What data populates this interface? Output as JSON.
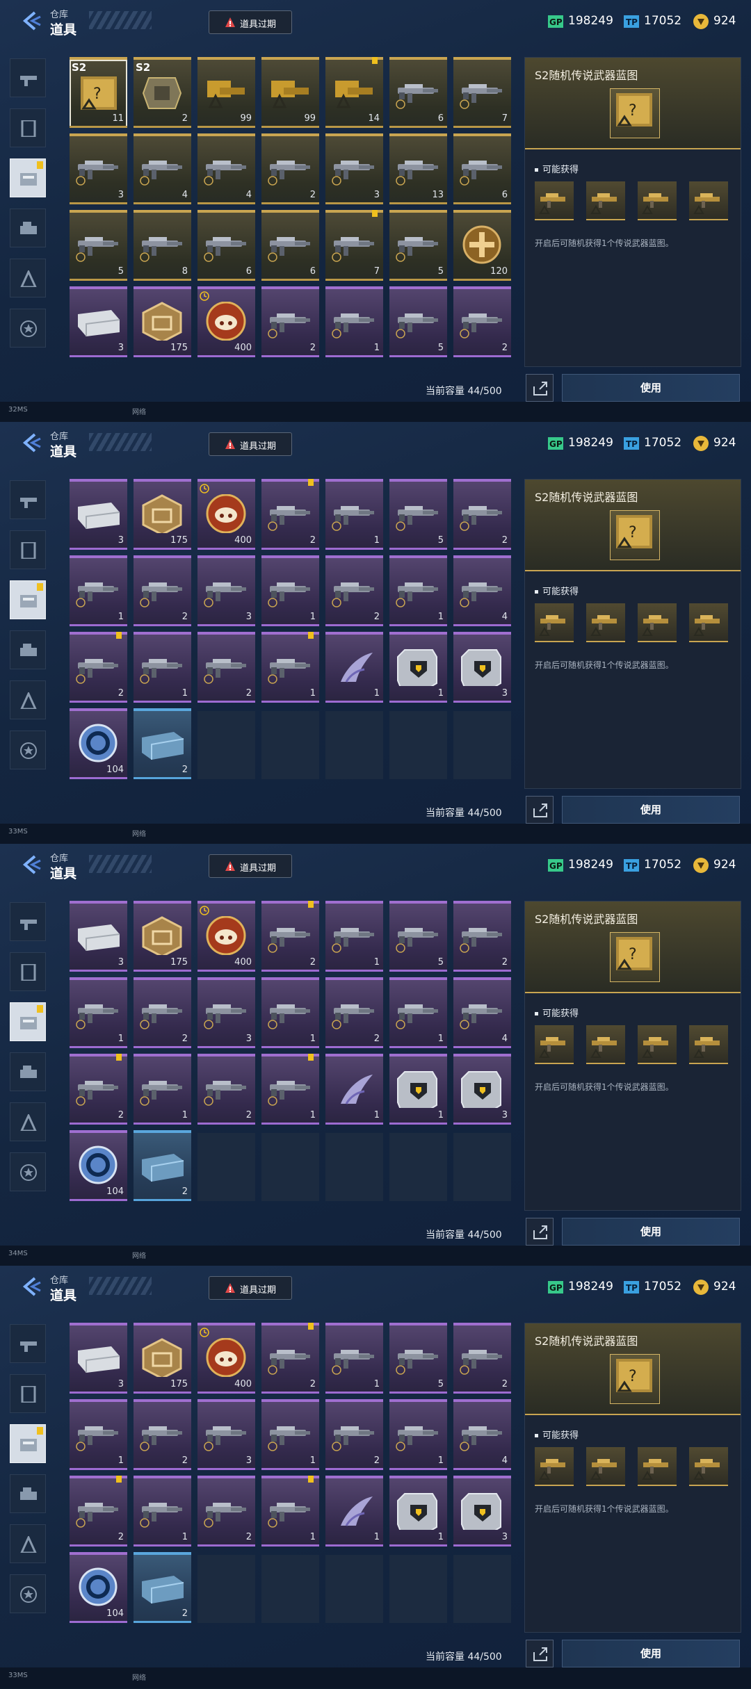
{
  "header": {
    "breadcrumb": "仓库",
    "title": "道具",
    "expired_label": "道具过期",
    "currencies": [
      {
        "icon": "gp-currency-icon",
        "value": "198249"
      },
      {
        "icon": "tp-currency-icon",
        "value": "17052"
      },
      {
        "icon": "gold-coin-icon",
        "value": "924"
      }
    ]
  },
  "tabs": [
    {
      "name": "weapons",
      "icon": "rifle-icon"
    },
    {
      "name": "cards",
      "icon": "card-icon"
    },
    {
      "name": "items",
      "icon": "item-pack-icon"
    },
    {
      "name": "vehicles",
      "icon": "vehicle-icon"
    },
    {
      "name": "blueprints",
      "icon": "blueprint-icon"
    },
    {
      "name": "badges",
      "icon": "star-badge-icon"
    }
  ],
  "detail": {
    "title": "S2随机传说武器蓝图",
    "obtain_label": "可能获得",
    "description": "开启后可随机获得1个传说武器蓝图。",
    "use_button": "使用"
  },
  "capacity": "当前容量 44/500",
  "screens": [
    {
      "fps": "32MS",
      "extra": "网络",
      "rows": [
        [
          {
            "rarity": "gold",
            "icon": "blueprint-crate-icon",
            "count": "11",
            "tag": "S2",
            "selected": true
          },
          {
            "rarity": "gold",
            "icon": "supply-crate-icon",
            "count": "2",
            "tag": "S2"
          },
          {
            "rarity": "gold",
            "icon": "gold-blueprint-icon",
            "count": "99"
          },
          {
            "rarity": "gold",
            "icon": "gold-blueprint-icon",
            "count": "99"
          },
          {
            "rarity": "gold",
            "icon": "gold-blueprint-icon",
            "count": "14",
            "new": true
          },
          {
            "rarity": "gold",
            "icon": "rifle-blueprint-icon",
            "count": "6"
          },
          {
            "rarity": "gold",
            "icon": "rifle-blueprint-icon",
            "count": "7"
          }
        ],
        [
          {
            "rarity": "gold",
            "icon": "rifle-blueprint-icon",
            "count": "3"
          },
          {
            "rarity": "gold",
            "icon": "rifle-blueprint-icon",
            "count": "4"
          },
          {
            "rarity": "gold",
            "icon": "rifle-blueprint-icon",
            "count": "4"
          },
          {
            "rarity": "gold",
            "icon": "rifle-blueprint-icon",
            "count": "2"
          },
          {
            "rarity": "gold",
            "icon": "rifle-blueprint-icon",
            "count": "3"
          },
          {
            "rarity": "gold",
            "icon": "rifle-blueprint-icon",
            "count": "13"
          },
          {
            "rarity": "gold",
            "icon": "rifle-blueprint-icon",
            "count": "6"
          }
        ],
        [
          {
            "rarity": "gold",
            "icon": "rifle-blueprint-icon",
            "count": "5"
          },
          {
            "rarity": "gold",
            "icon": "rifle-blueprint-icon",
            "count": "8"
          },
          {
            "rarity": "gold",
            "icon": "rifle-blueprint-icon",
            "count": "6"
          },
          {
            "rarity": "gold",
            "icon": "rifle-blueprint-icon",
            "count": "6"
          },
          {
            "rarity": "gold",
            "icon": "rifle-blueprint-icon",
            "count": "7",
            "new": true
          },
          {
            "rarity": "gold",
            "icon": "rifle-blueprint-icon",
            "count": "5"
          },
          {
            "rarity": "gold",
            "icon": "gold-cross-coin-icon",
            "count": "120"
          }
        ],
        [
          {
            "rarity": "purple",
            "icon": "silver-case-icon",
            "count": "3"
          },
          {
            "rarity": "purple",
            "icon": "hex-badge-icon",
            "count": "175"
          },
          {
            "rarity": "purple",
            "icon": "pig-token-icon",
            "count": "400",
            "clock": true
          },
          {
            "rarity": "purple",
            "icon": "rifle-blueprint-icon",
            "count": "2"
          },
          {
            "rarity": "purple",
            "icon": "rifle-blueprint-icon",
            "count": "1"
          },
          {
            "rarity": "purple",
            "icon": "rifle-blueprint-icon",
            "count": "5"
          },
          {
            "rarity": "purple",
            "icon": "rifle-blueprint-icon",
            "count": "2"
          }
        ]
      ]
    },
    {
      "fps": "33MS",
      "extra": "网络",
      "rows": [
        [
          {
            "rarity": "purple",
            "icon": "silver-case-icon",
            "count": "3"
          },
          {
            "rarity": "purple",
            "icon": "hex-badge-icon",
            "count": "175"
          },
          {
            "rarity": "purple",
            "icon": "pig-token-icon",
            "count": "400",
            "clock": true
          },
          {
            "rarity": "purple",
            "icon": "rifle-blueprint-icon",
            "count": "2",
            "new": true
          },
          {
            "rarity": "purple",
            "icon": "rifle-blueprint-icon",
            "count": "1"
          },
          {
            "rarity": "purple",
            "icon": "rifle-blueprint-icon",
            "count": "5"
          },
          {
            "rarity": "purple",
            "icon": "rifle-blueprint-icon",
            "count": "2"
          }
        ],
        [
          {
            "rarity": "purple",
            "icon": "rifle-blueprint-icon",
            "count": "1"
          },
          {
            "rarity": "purple",
            "icon": "rifle-blueprint-icon",
            "count": "2"
          },
          {
            "rarity": "purple",
            "icon": "rifle-blueprint-icon",
            "count": "3"
          },
          {
            "rarity": "purple",
            "icon": "rifle-blueprint-icon",
            "count": "1"
          },
          {
            "rarity": "purple",
            "icon": "rifle-blueprint-icon",
            "count": "2"
          },
          {
            "rarity": "purple",
            "icon": "rifle-blueprint-icon",
            "count": "1"
          },
          {
            "rarity": "purple",
            "icon": "rifle-blueprint-icon",
            "count": "4"
          }
        ],
        [
          {
            "rarity": "purple",
            "icon": "rifle-blueprint-icon",
            "count": "2",
            "new": true
          },
          {
            "rarity": "purple",
            "icon": "rifle-blueprint-icon",
            "count": "1"
          },
          {
            "rarity": "purple",
            "icon": "rifle-blueprint-icon",
            "count": "2"
          },
          {
            "rarity": "purple",
            "icon": "rifle-blueprint-icon",
            "count": "1",
            "new": true
          },
          {
            "rarity": "purple",
            "icon": "claw-blade-icon",
            "count": "1"
          },
          {
            "rarity": "purple",
            "icon": "shield-card-icon",
            "count": "1"
          },
          {
            "rarity": "purple",
            "icon": "shield-card-icon",
            "count": "3"
          }
        ],
        [
          {
            "rarity": "purple",
            "icon": "blue-ring-token-icon",
            "count": "104"
          },
          {
            "rarity": "blue",
            "icon": "supply-box-icon",
            "count": "2"
          },
          {
            "rarity": "empty"
          },
          {
            "rarity": "empty"
          },
          {
            "rarity": "empty"
          },
          {
            "rarity": "empty"
          },
          {
            "rarity": "empty"
          }
        ]
      ]
    },
    {
      "fps": "34MS",
      "extra": "网络",
      "rows": [
        [
          {
            "rarity": "purple",
            "icon": "silver-case-icon",
            "count": "3"
          },
          {
            "rarity": "purple",
            "icon": "hex-badge-icon",
            "count": "175"
          },
          {
            "rarity": "purple",
            "icon": "pig-token-icon",
            "count": "400",
            "clock": true
          },
          {
            "rarity": "purple",
            "icon": "rifle-blueprint-icon",
            "count": "2",
            "new": true
          },
          {
            "rarity": "purple",
            "icon": "rifle-blueprint-icon",
            "count": "1"
          },
          {
            "rarity": "purple",
            "icon": "rifle-blueprint-icon",
            "count": "5"
          },
          {
            "rarity": "purple",
            "icon": "rifle-blueprint-icon",
            "count": "2"
          }
        ],
        [
          {
            "rarity": "purple",
            "icon": "rifle-blueprint-icon",
            "count": "1"
          },
          {
            "rarity": "purple",
            "icon": "rifle-blueprint-icon",
            "count": "2"
          },
          {
            "rarity": "purple",
            "icon": "rifle-blueprint-icon",
            "count": "3"
          },
          {
            "rarity": "purple",
            "icon": "rifle-blueprint-icon",
            "count": "1"
          },
          {
            "rarity": "purple",
            "icon": "rifle-blueprint-icon",
            "count": "2"
          },
          {
            "rarity": "purple",
            "icon": "rifle-blueprint-icon",
            "count": "1"
          },
          {
            "rarity": "purple",
            "icon": "rifle-blueprint-icon",
            "count": "4"
          }
        ],
        [
          {
            "rarity": "purple",
            "icon": "rifle-blueprint-icon",
            "count": "2",
            "new": true
          },
          {
            "rarity": "purple",
            "icon": "rifle-blueprint-icon",
            "count": "1"
          },
          {
            "rarity": "purple",
            "icon": "rifle-blueprint-icon",
            "count": "2"
          },
          {
            "rarity": "purple",
            "icon": "rifle-blueprint-icon",
            "count": "1",
            "new": true
          },
          {
            "rarity": "purple",
            "icon": "claw-blade-icon",
            "count": "1"
          },
          {
            "rarity": "purple",
            "icon": "shield-card-icon",
            "count": "1"
          },
          {
            "rarity": "purple",
            "icon": "shield-card-icon",
            "count": "3"
          }
        ],
        [
          {
            "rarity": "purple",
            "icon": "blue-ring-token-icon",
            "count": "104"
          },
          {
            "rarity": "blue",
            "icon": "supply-box-icon",
            "count": "2"
          },
          {
            "rarity": "empty"
          },
          {
            "rarity": "empty"
          },
          {
            "rarity": "empty"
          },
          {
            "rarity": "empty"
          },
          {
            "rarity": "empty"
          }
        ]
      ]
    },
    {
      "fps": "33MS",
      "extra": "网络",
      "rows": [
        [
          {
            "rarity": "purple",
            "icon": "silver-case-icon",
            "count": "3"
          },
          {
            "rarity": "purple",
            "icon": "hex-badge-icon",
            "count": "175"
          },
          {
            "rarity": "purple",
            "icon": "pig-token-icon",
            "count": "400",
            "clock": true
          },
          {
            "rarity": "purple",
            "icon": "rifle-blueprint-icon",
            "count": "2",
            "new": true
          },
          {
            "rarity": "purple",
            "icon": "rifle-blueprint-icon",
            "count": "1"
          },
          {
            "rarity": "purple",
            "icon": "rifle-blueprint-icon",
            "count": "5"
          },
          {
            "rarity": "purple",
            "icon": "rifle-blueprint-icon",
            "count": "2"
          }
        ],
        [
          {
            "rarity": "purple",
            "icon": "rifle-blueprint-icon",
            "count": "1"
          },
          {
            "rarity": "purple",
            "icon": "rifle-blueprint-icon",
            "count": "2"
          },
          {
            "rarity": "purple",
            "icon": "rifle-blueprint-icon",
            "count": "3"
          },
          {
            "rarity": "purple",
            "icon": "rifle-blueprint-icon",
            "count": "1"
          },
          {
            "rarity": "purple",
            "icon": "rifle-blueprint-icon",
            "count": "2"
          },
          {
            "rarity": "purple",
            "icon": "rifle-blueprint-icon",
            "count": "1"
          },
          {
            "rarity": "purple",
            "icon": "rifle-blueprint-icon",
            "count": "4"
          }
        ],
        [
          {
            "rarity": "purple",
            "icon": "rifle-blueprint-icon",
            "count": "2",
            "new": true
          },
          {
            "rarity": "purple",
            "icon": "rifle-blueprint-icon",
            "count": "1"
          },
          {
            "rarity": "purple",
            "icon": "rifle-blueprint-icon",
            "count": "2"
          },
          {
            "rarity": "purple",
            "icon": "rifle-blueprint-icon",
            "count": "1",
            "new": true
          },
          {
            "rarity": "purple",
            "icon": "claw-blade-icon",
            "count": "1"
          },
          {
            "rarity": "purple",
            "icon": "shield-card-icon",
            "count": "1"
          },
          {
            "rarity": "purple",
            "icon": "shield-card-icon",
            "count": "3"
          }
        ],
        [
          {
            "rarity": "purple",
            "icon": "blue-ring-token-icon",
            "count": "104"
          },
          {
            "rarity": "blue",
            "icon": "supply-box-icon",
            "count": "2"
          },
          {
            "rarity": "empty"
          },
          {
            "rarity": "empty"
          },
          {
            "rarity": "empty"
          },
          {
            "rarity": "empty"
          },
          {
            "rarity": "empty"
          }
        ]
      ]
    }
  ],
  "colors": {
    "gold": "#c9a551",
    "purple": "#a06fd0",
    "blue": "#5aa7dd",
    "new_badge": "#f0c01e",
    "gp": "#37c98a",
    "tp": "#3aa0e0"
  }
}
